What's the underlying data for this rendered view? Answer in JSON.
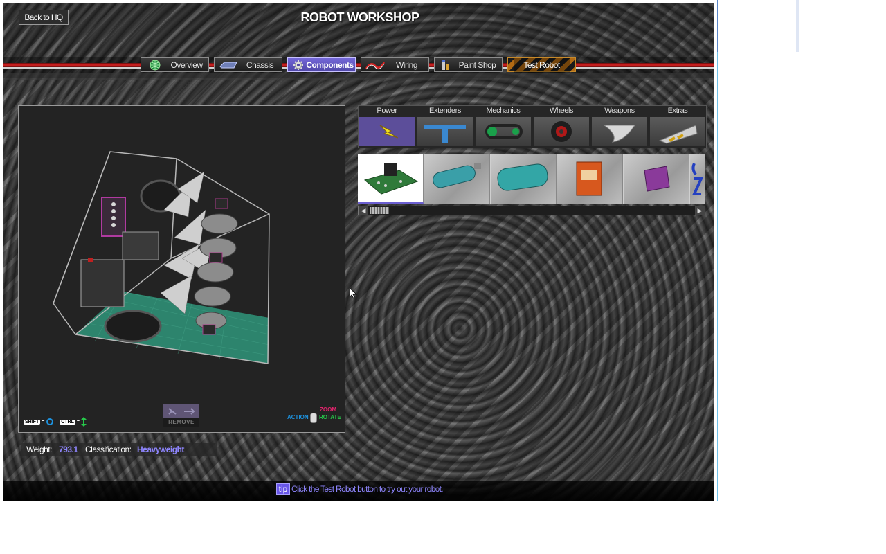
{
  "header": {
    "back_label": "Back to HQ",
    "title": "ROBOT WORKSHOP"
  },
  "tabs": [
    {
      "label": "Overview",
      "icon": "globe-icon"
    },
    {
      "label": "Chassis",
      "icon": "chassis-icon"
    },
    {
      "label": "Components",
      "icon": "gear-icon",
      "active": true
    },
    {
      "label": "Wiring",
      "icon": "wire-icon"
    },
    {
      "label": "Paint Shop",
      "icon": "paint-can-icon"
    },
    {
      "label": "Test Robot",
      "icon": "hazard-stripes"
    }
  ],
  "viewport": {
    "shift_key": "SHIFT",
    "ctrl_key": "CTRL",
    "remove_label": "REMOVE",
    "zoom_label": "ZOOM",
    "action_label": "ACTION",
    "rotate_label": "ROTATE"
  },
  "stats": {
    "weight_label": "Weight:",
    "weight_value": "793.1",
    "class_label": "Classification:",
    "class_value": "Heavyweight"
  },
  "categories": [
    {
      "label": "Power",
      "icon": "lightning-icon",
      "active": true
    },
    {
      "label": "Extenders",
      "icon": "extender-bar-icon"
    },
    {
      "label": "Mechanics",
      "icon": "chain-gear-icon"
    },
    {
      "label": "Wheels",
      "icon": "wheel-icon"
    },
    {
      "label": "Weapons",
      "icon": "blade-icon"
    },
    {
      "label": "Extras",
      "icon": "wedge-icon"
    }
  ],
  "components": [
    {
      "name": "circuit-board",
      "selected": true
    },
    {
      "name": "co2-tank-small"
    },
    {
      "name": "co2-tank-large"
    },
    {
      "name": "orange-battery"
    },
    {
      "name": "purple-battery"
    },
    {
      "name": "partial-item"
    }
  ],
  "tip": {
    "badge": "tip",
    "text": "Click the Test Robot button to try out your robot."
  },
  "colors": {
    "accent": "#6b5fd0",
    "value_text": "#8f86ff",
    "floor": "#2f8f76"
  }
}
